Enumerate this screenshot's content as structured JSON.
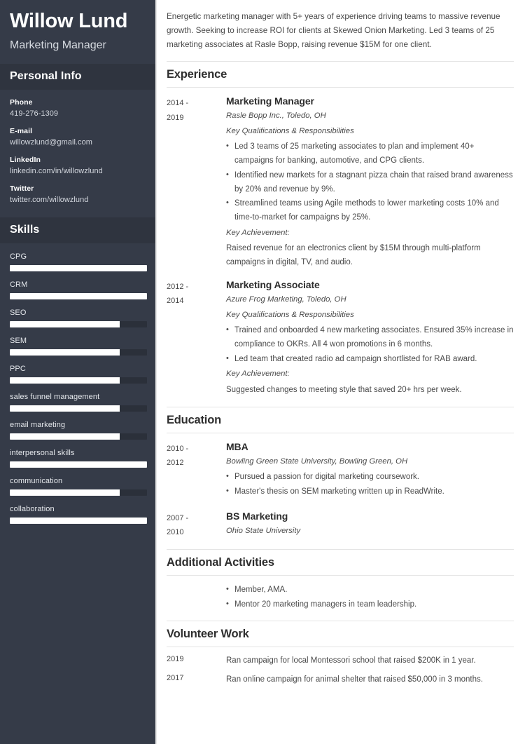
{
  "sidebar": {
    "name": "Willow Lund",
    "job_title": "Marketing Manager",
    "personal_info_heading": "Personal Info",
    "contacts": [
      {
        "label": "Phone",
        "value": "419-276-1309"
      },
      {
        "label": "E-mail",
        "value": "willowzlund@gmail.com"
      },
      {
        "label": "LinkedIn",
        "value": "linkedin.com/in/willowzlund"
      },
      {
        "label": "Twitter",
        "value": "twitter.com/willowzlund"
      }
    ],
    "skills_heading": "Skills",
    "skills": [
      {
        "name": "CPG",
        "level": 100
      },
      {
        "name": "CRM",
        "level": 100
      },
      {
        "name": "SEO",
        "level": 80
      },
      {
        "name": "SEM",
        "level": 80
      },
      {
        "name": "PPC",
        "level": 80
      },
      {
        "name": "sales funnel management",
        "level": 80
      },
      {
        "name": "email marketing",
        "level": 80
      },
      {
        "name": "interpersonal skills",
        "level": 100
      },
      {
        "name": "communication",
        "level": 80
      },
      {
        "name": "collaboration",
        "level": 100
      }
    ]
  },
  "main": {
    "summary": "Energetic marketing manager with 5+ years of experience driving teams to massive revenue growth. Seeking to increase ROI for clients at Skewed Onion Marketing. Led 3 teams of 25 marketing associates at Rasle Bopp, raising revenue $15M for one client.",
    "experience": {
      "heading": "Experience",
      "entries": [
        {
          "date_start": "2014 -",
          "date_end": "2019",
          "title": "Marketing Manager",
          "subtitle": "Rasle Bopp Inc., Toledo, OH",
          "kicker": "Key Qualifications & Responsibilities",
          "bullets": [
            "Led 3 teams of 25 marketing associates to plan and implement 40+ campaigns for banking, automotive, and CPG clients.",
            "Identified new markets for a stagnant pizza chain that raised brand awareness by 20% and revenue by 9%.",
            "Streamlined teams using Agile methods to lower marketing costs 10% and time-to-market for campaigns by 25%."
          ],
          "achievement_label": "Key Achievement:",
          "achievement_text": "Raised revenue for an electronics client by $15M through multi-platform campaigns in digital, TV, and audio."
        },
        {
          "date_start": "2012 -",
          "date_end": "2014",
          "title": "Marketing Associate",
          "subtitle": "Azure Frog Marketing, Toledo, OH",
          "kicker": "Key Qualifications & Responsibilities",
          "bullets": [
            "Trained and onboarded 4 new marketing associates. Ensured 35% increase in compliance to OKRs. All 4 won promotions in 6 months.",
            "Led team that created radio ad campaign shortlisted for RAB award."
          ],
          "achievement_label": "Key Achievement:",
          "achievement_text": "Suggested changes to meeting style that saved 20+ hrs per week."
        }
      ]
    },
    "education": {
      "heading": "Education",
      "entries": [
        {
          "date_start": "2010 -",
          "date_end": "2012",
          "title": "MBA",
          "subtitle": "Bowling Green State University, Bowling Green, OH",
          "bullets": [
            "Pursued a passion for digital marketing coursework.",
            "Master's thesis on SEM marketing written up in ReadWrite."
          ]
        },
        {
          "date_start": "2007 -",
          "date_end": "2010",
          "title": "BS Marketing",
          "subtitle": "Ohio State University",
          "bullets": []
        }
      ]
    },
    "activities": {
      "heading": "Additional Activities",
      "bullets": [
        "Member, AMA.",
        "Mentor 20 marketing managers in team leadership."
      ]
    },
    "volunteer": {
      "heading": "Volunteer Work",
      "rows": [
        {
          "date": "2019",
          "text": "Ran campaign for local Montessori school that raised $200K in 1 year."
        },
        {
          "date": "2017",
          "text": "Ran online campaign for animal shelter that raised $50,000 in 3 months."
        }
      ]
    }
  },
  "colors": {
    "sidebar_bg": "#353b48",
    "sidebar_head_bg": "#2f343f",
    "skill_track": "#2b303a",
    "skill_fill": "#ffffff",
    "rule": "#e4e4e4"
  }
}
